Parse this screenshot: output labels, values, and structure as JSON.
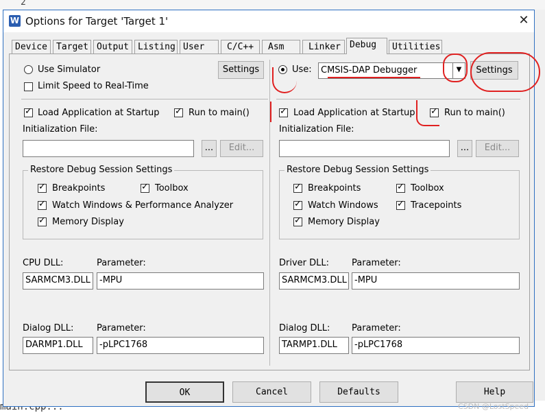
{
  "background": {
    "line_number": "2",
    "bottom_code": "main.cpp..."
  },
  "window": {
    "title": "Options for Target 'Target 1'",
    "app_icon": "W",
    "close": "✕"
  },
  "tabs": [
    {
      "label": "Device"
    },
    {
      "label": "Target"
    },
    {
      "label": "Output"
    },
    {
      "label": "Listing"
    },
    {
      "label": "User"
    },
    {
      "label": "C/C++"
    },
    {
      "label": "Asm"
    },
    {
      "label": "Linker"
    },
    {
      "label": "Debug",
      "active": true
    },
    {
      "label": "Utilities"
    }
  ],
  "left": {
    "use_simulator": "Use Simulator",
    "settings": "Settings",
    "limit_speed": "Limit Speed to Real-Time",
    "load_app": "Load Application at Startup",
    "run_to_main": "Run to main()",
    "init_file": "Initialization File:",
    "browse": "...",
    "edit": "Edit...",
    "restore_title": "Restore Debug Session Settings",
    "breakpoints": "Breakpoints",
    "toolbox": "Toolbox",
    "watch": "Watch Windows & Performance Analyzer",
    "memory": "Memory Display",
    "cpu_dll_label": "CPU DLL:",
    "param_label": "Parameter:",
    "cpu_dll": "SARMCM3.DLL",
    "cpu_param": "-MPU",
    "dialog_dll_label": "Dialog DLL:",
    "dialog_dll": "DARMP1.DLL",
    "dialog_param": "-pLPC1768"
  },
  "right": {
    "use": "Use:",
    "debugger": "CMSIS-DAP Debugger",
    "settings": "Settings",
    "load_app": "Load Application at Startup",
    "run_to_main": "Run to main()",
    "init_file": "Initialization File:",
    "browse": "...",
    "edit": "Edit...",
    "restore_title": "Restore Debug Session Settings",
    "breakpoints": "Breakpoints",
    "toolbox": "Toolbox",
    "watch": "Watch Windows",
    "tracepoints": "Tracepoints",
    "memory": "Memory Display",
    "driver_dll_label": "Driver DLL:",
    "param_label": "Parameter:",
    "driver_dll": "SARMCM3.DLL",
    "driver_param": "-MPU",
    "dialog_dll_label": "Dialog DLL:",
    "dialog_dll": "TARMP1.DLL",
    "dialog_param": "-pLPC1768"
  },
  "footer": {
    "ok": "OK",
    "cancel": "Cancel",
    "defaults": "Defaults",
    "help": "Help"
  },
  "watermark": "CSDN @LostSpeed",
  "annotation_color": "#e02020"
}
